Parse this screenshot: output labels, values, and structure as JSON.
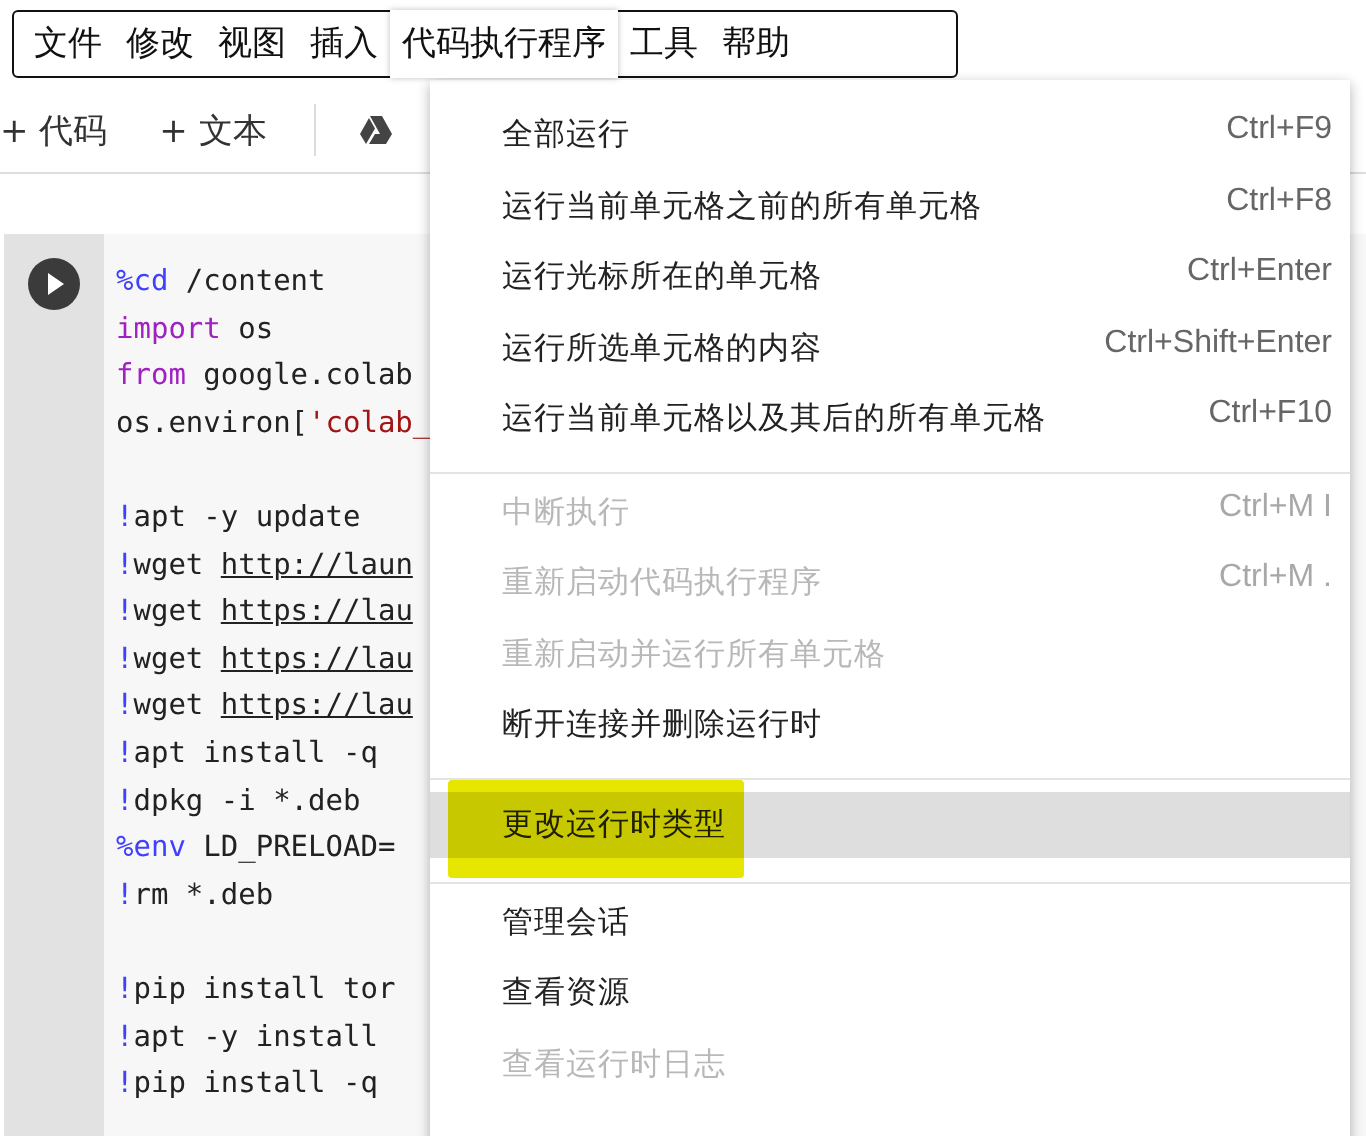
{
  "menubar": [
    {
      "label": "文件",
      "selected": false
    },
    {
      "label": "修改",
      "selected": false
    },
    {
      "label": "视图",
      "selected": false
    },
    {
      "label": "插入",
      "selected": false
    },
    {
      "label": "代码执行程序",
      "selected": true
    },
    {
      "label": "工具",
      "selected": false
    },
    {
      "label": "帮助",
      "selected": false
    }
  ],
  "toolbar": {
    "add_code": "+ 代码",
    "add_text": "+ 文本"
  },
  "code_cell": {
    "lines": [
      {
        "kind": "magic",
        "head": "%cd",
        "rest": " /content"
      },
      {
        "kind": "keyword",
        "head": "import",
        "rest": " os"
      },
      {
        "kind": "keyword",
        "head": "from",
        "rest": " google.colab"
      },
      {
        "kind": "string",
        "head": "os.environ[",
        "rest": "'colab_"
      },
      {
        "kind": "blank"
      },
      {
        "kind": "shell",
        "head": "!",
        "rest": "apt -y update"
      },
      {
        "kind": "shell",
        "head": "!",
        "rest": "wget ",
        "link": "http://laun"
      },
      {
        "kind": "shell",
        "head": "!",
        "rest": "wget ",
        "link": "https://lau"
      },
      {
        "kind": "shell",
        "head": "!",
        "rest": "wget ",
        "link": "https://lau"
      },
      {
        "kind": "shell",
        "head": "!",
        "rest": "wget ",
        "link": "https://lau"
      },
      {
        "kind": "shell",
        "head": "!",
        "rest": "apt install -q"
      },
      {
        "kind": "shell",
        "head": "!",
        "rest": "dpkg -i *.deb"
      },
      {
        "kind": "magic",
        "head": "%env",
        "rest": " LD_PRELOAD="
      },
      {
        "kind": "shell",
        "head": "!",
        "rest": "rm *.deb"
      },
      {
        "kind": "blank"
      },
      {
        "kind": "shell",
        "head": "!",
        "rest": "pip install tor"
      },
      {
        "kind": "shell",
        "head": "!",
        "rest": "apt -y install"
      },
      {
        "kind": "shell",
        "head": "!",
        "rest": "pip install -q"
      }
    ]
  },
  "menu": {
    "items": [
      {
        "kind": "item",
        "label": "全部运行",
        "shortcut": "Ctrl+F9",
        "disabled": false,
        "selected": false,
        "marked": false
      },
      {
        "kind": "item",
        "label": "运行当前单元格之前的所有单元格",
        "shortcut": "Ctrl+F8",
        "disabled": false,
        "selected": false,
        "marked": false
      },
      {
        "kind": "item",
        "label": "运行光标所在的单元格",
        "shortcut": "Ctrl+Enter",
        "disabled": false,
        "selected": false,
        "marked": false
      },
      {
        "kind": "item",
        "label": "运行所选单元格的内容",
        "shortcut": "Ctrl+Shift+Enter",
        "disabled": false,
        "selected": false,
        "marked": false
      },
      {
        "kind": "item",
        "label": "运行当前单元格以及其后的所有单元格",
        "shortcut": "Ctrl+F10",
        "disabled": false,
        "selected": false,
        "marked": false
      },
      {
        "kind": "divider"
      },
      {
        "kind": "item",
        "label": "中断执行",
        "shortcut": "Ctrl+M I",
        "disabled": true,
        "selected": false,
        "marked": false
      },
      {
        "kind": "item",
        "label": "重新启动代码执行程序",
        "shortcut": "Ctrl+M .",
        "disabled": true,
        "selected": false,
        "marked": false
      },
      {
        "kind": "item",
        "label": "重新启动并运行所有单元格",
        "disabled": true,
        "selected": false,
        "marked": false
      },
      {
        "kind": "item",
        "label": "断开连接并删除运行时",
        "disabled": false,
        "selected": false,
        "marked": false
      },
      {
        "kind": "divider"
      },
      {
        "kind": "item",
        "label": "更改运行时类型",
        "disabled": false,
        "selected": true,
        "marked": true
      },
      {
        "kind": "divider"
      },
      {
        "kind": "item",
        "label": "管理会话",
        "disabled": false,
        "selected": false,
        "marked": false
      },
      {
        "kind": "item",
        "label": "查看资源",
        "disabled": false,
        "selected": false,
        "marked": false
      },
      {
        "kind": "item",
        "label": "查看运行时日志",
        "disabled": true,
        "selected": false,
        "marked": false
      }
    ]
  }
}
